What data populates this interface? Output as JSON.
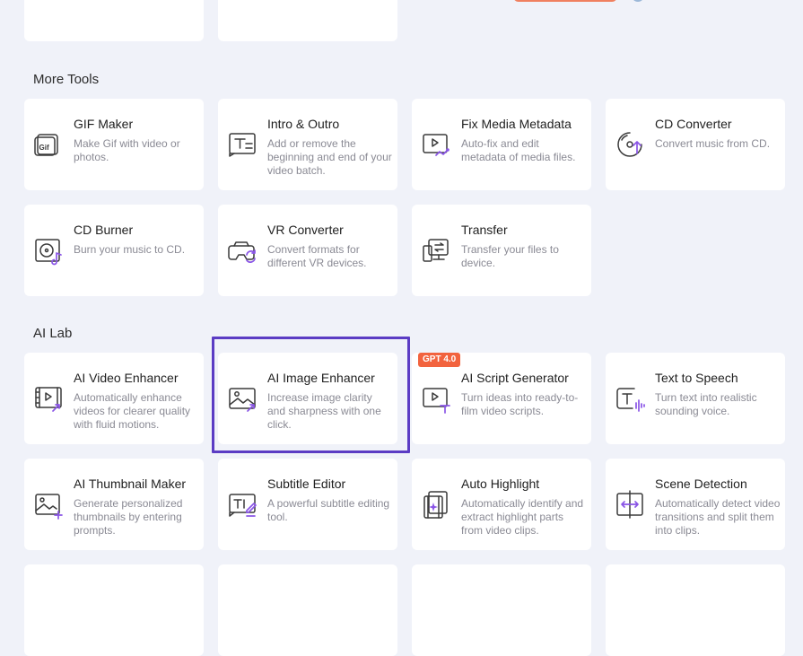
{
  "sections": {
    "more_tools_title": "More Tools",
    "ai_lab_title": "AI Lab"
  },
  "more_tools": [
    {
      "title": "GIF Maker",
      "desc": "Make Gif with video or photos.",
      "icon": "gif-icon"
    },
    {
      "title": "Intro & Outro",
      "desc": "Add or remove the beginning and end of your video batch.",
      "icon": "intro-outro-icon"
    },
    {
      "title": "Fix Media Metadata",
      "desc": "Auto-fix and edit metadata of media files.",
      "icon": "metadata-icon"
    },
    {
      "title": "CD Converter",
      "desc": "Convert music from CD.",
      "icon": "cd-converter-icon"
    },
    {
      "title": "CD Burner",
      "desc": "Burn your music to CD.",
      "icon": "cd-burner-icon"
    },
    {
      "title": "VR Converter",
      "desc": "Convert formats for different VR devices.",
      "icon": "vr-icon"
    },
    {
      "title": "Transfer",
      "desc": "Transfer your files to device.",
      "icon": "transfer-icon"
    }
  ],
  "ai_lab": [
    {
      "title": "AI Video Enhancer",
      "desc": "Automatically enhance videos for clearer quality with fluid motions.",
      "icon": "video-enhancer-icon"
    },
    {
      "title": "AI Image Enhancer",
      "desc": "Increase image clarity and sharpness with one click.",
      "icon": "image-enhancer-icon",
      "selected": true
    },
    {
      "title": "AI Script Generator",
      "desc": "Turn ideas into ready-to-film video scripts.",
      "icon": "script-generator-icon",
      "badge": "GPT 4.0"
    },
    {
      "title": "Text to Speech",
      "desc": "Turn text into realistic sounding voice.",
      "icon": "text-to-speech-icon"
    },
    {
      "title": "AI Thumbnail Maker",
      "desc": "Generate personalized thumbnails by entering prompts.",
      "icon": "thumbnail-maker-icon"
    },
    {
      "title": "Subtitle Editor",
      "desc": "A powerful subtitle editing tool.",
      "icon": "subtitle-editor-icon"
    },
    {
      "title": "Auto Highlight",
      "desc": "Automatically identify and extract highlight parts from video clips.",
      "icon": "auto-highlight-icon"
    },
    {
      "title": "Scene Detection",
      "desc": "Automatically detect video transitions and split them into clips.",
      "icon": "scene-detection-icon"
    }
  ],
  "colors": {
    "background": "#f0f2f9",
    "card": "#ffffff",
    "accent_purple": "#8a55e6",
    "selection_border": "#5b3cc4",
    "badge": "#f2633e"
  }
}
